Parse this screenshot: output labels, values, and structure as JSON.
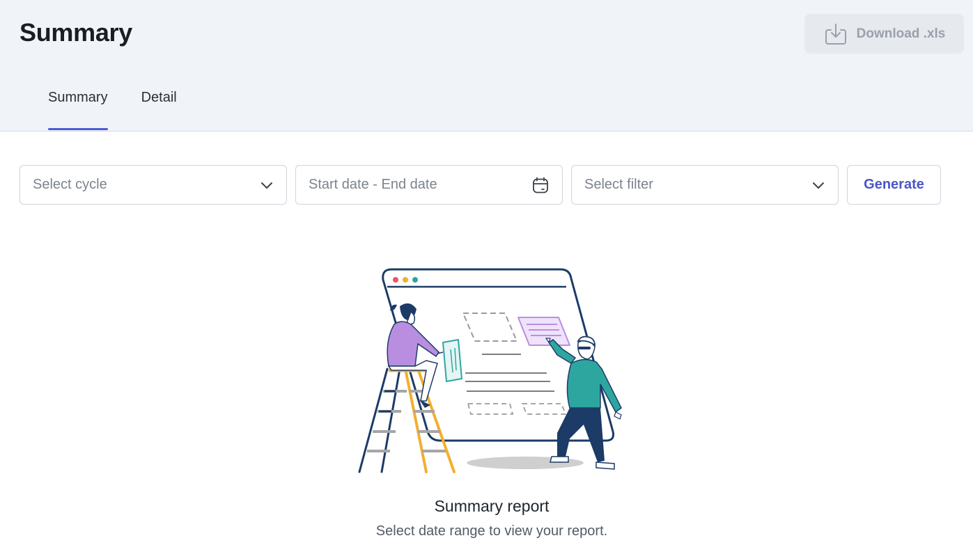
{
  "header": {
    "title": "Summary",
    "download_label": "Download .xls"
  },
  "tabs": [
    {
      "label": "Summary",
      "active": true
    },
    {
      "label": "Detail",
      "active": false
    }
  ],
  "filters": {
    "cycle_placeholder": "Select cycle",
    "date_placeholder": "Start date - End date",
    "filter_placeholder": "Select filter",
    "generate_label": "Generate"
  },
  "empty_state": {
    "title": "Summary report",
    "subtitle": "Select date range to view your report."
  },
  "colors": {
    "accent": "#4c5bd4",
    "header_bg": "#f0f3f8",
    "dark_navy": "#1c3b66",
    "teal": "#2ea6a0",
    "purple": "#b98ee0",
    "yellow": "#f2b02e"
  }
}
